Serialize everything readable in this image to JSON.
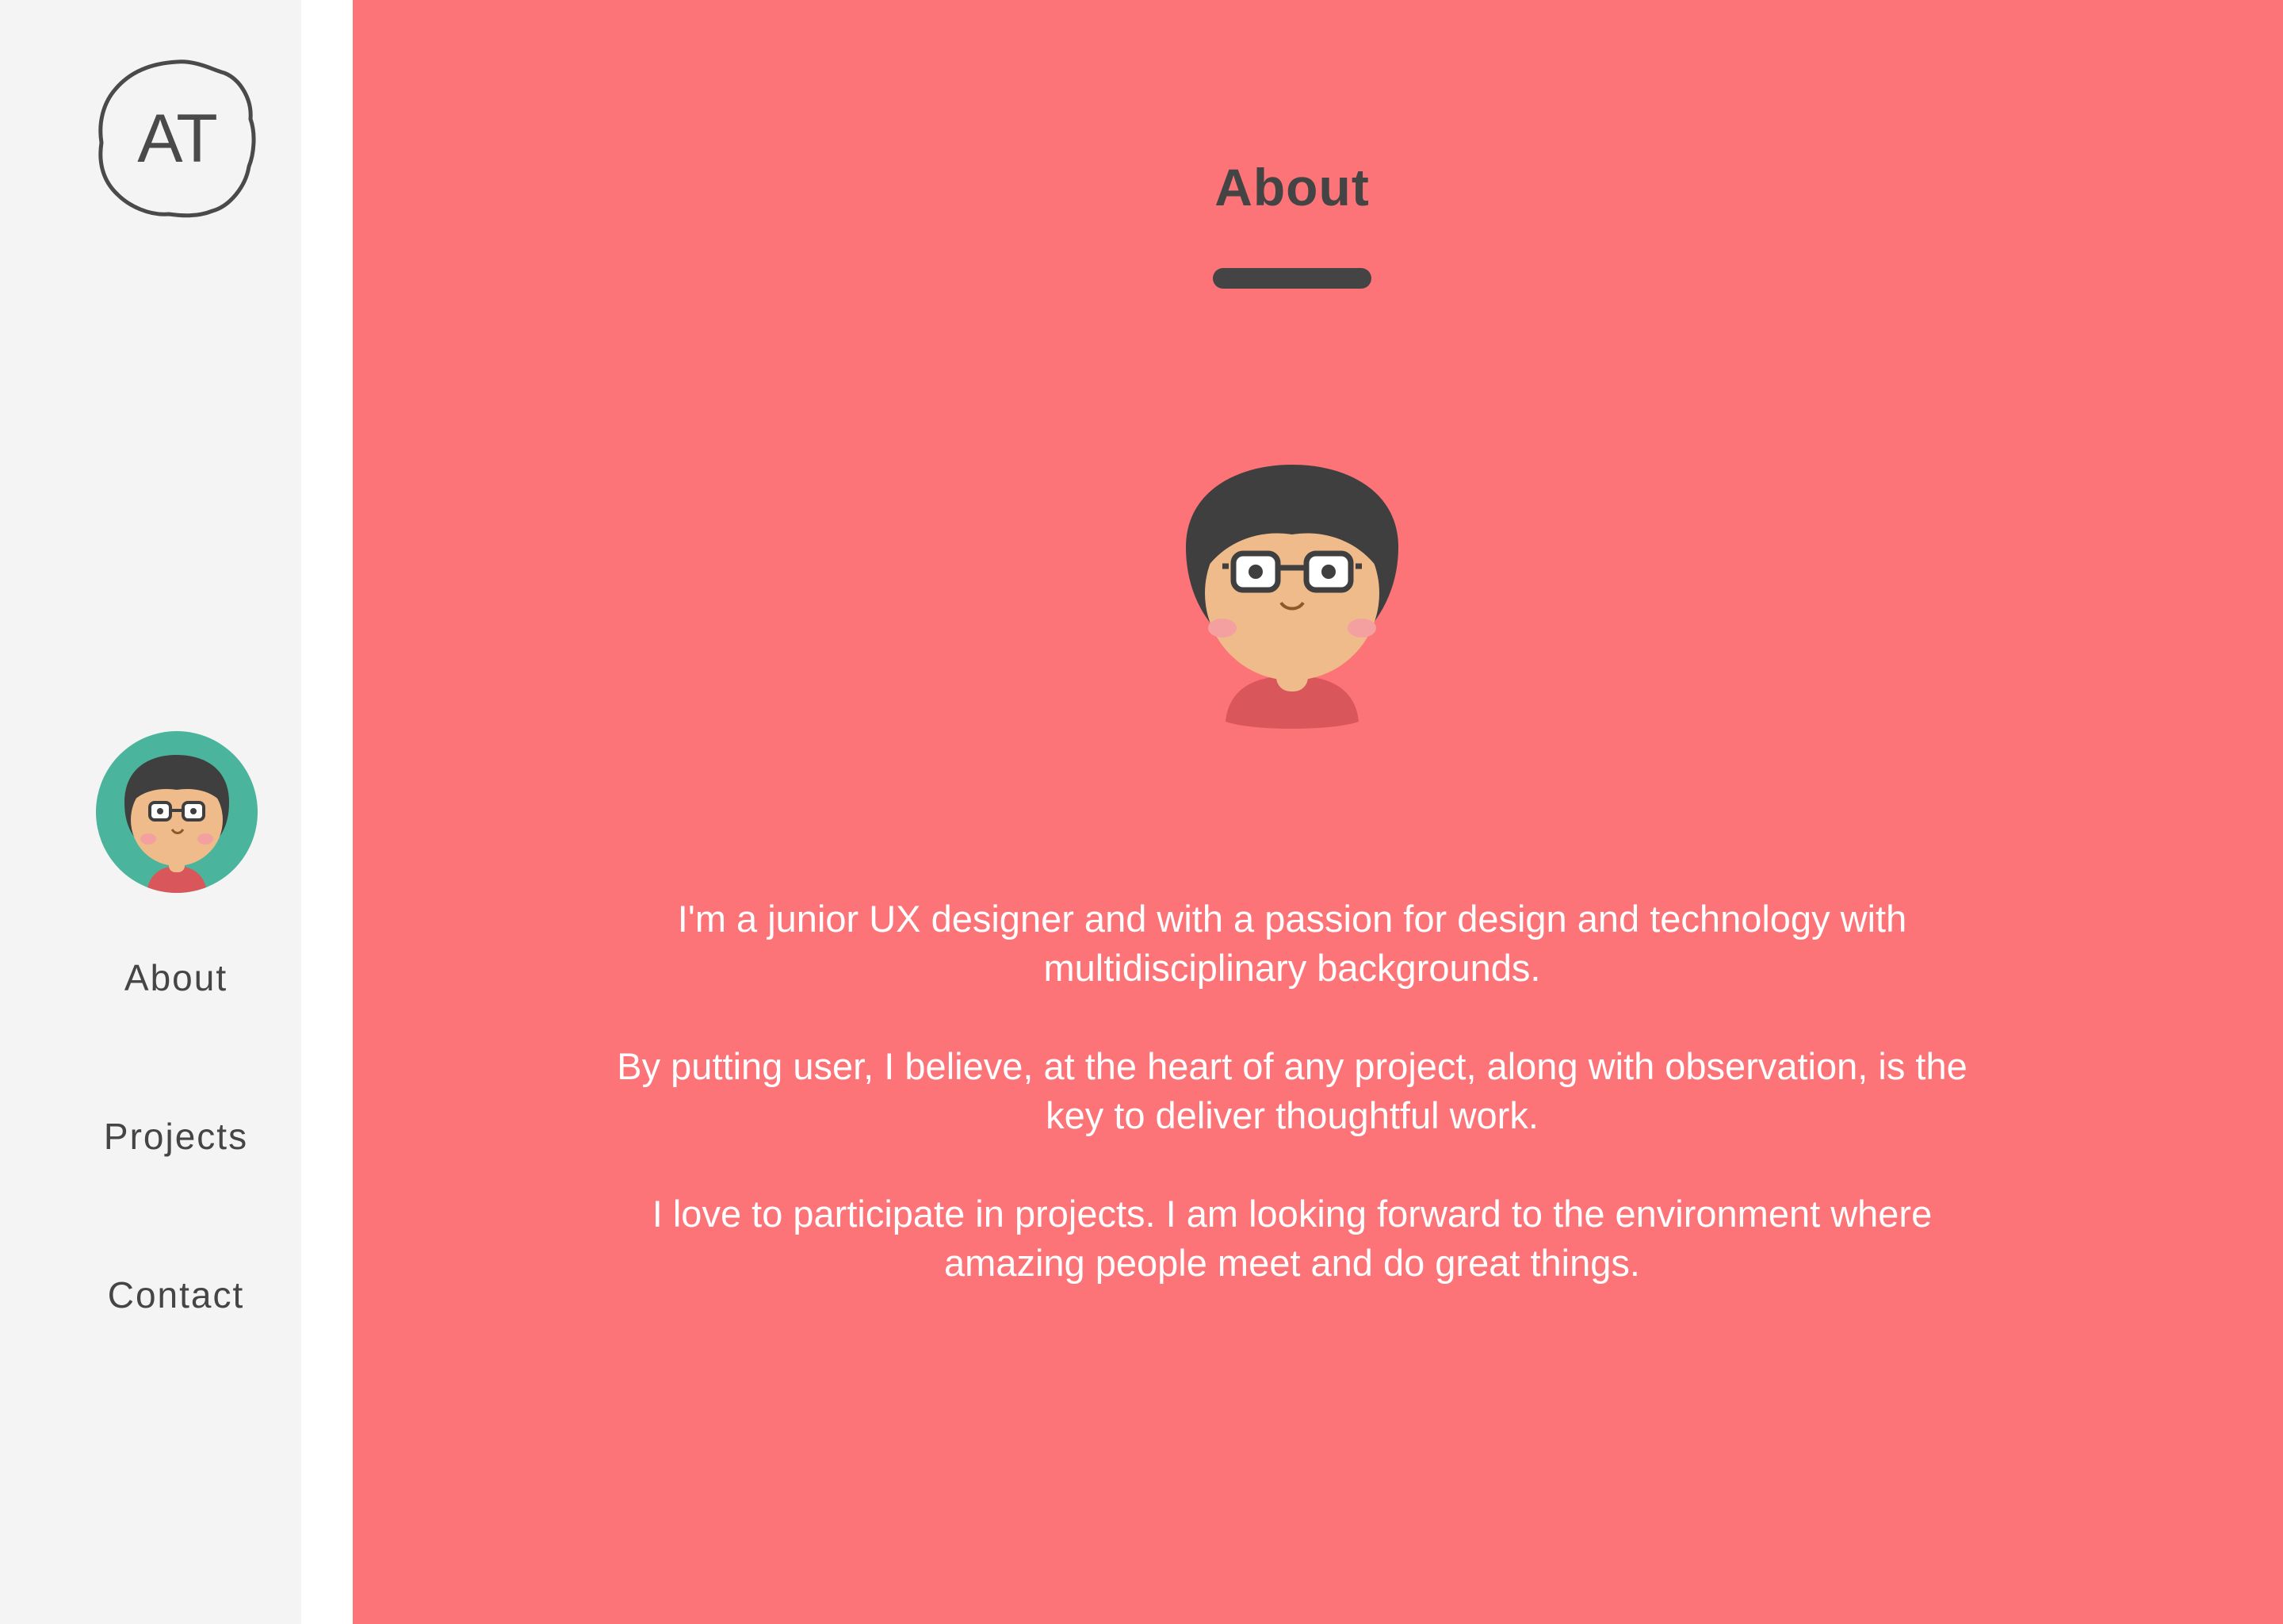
{
  "logo": {
    "initials": "AT"
  },
  "nav": {
    "items": [
      {
        "label": "About"
      },
      {
        "label": "Projects"
      },
      {
        "label": "Contact"
      }
    ]
  },
  "main": {
    "title": "About",
    "paragraphs": [
      "I'm a junior UX designer and with a passion for design and technology with multidisciplinary backgrounds.",
      "By putting user, I believe, at the heart of any project, along with observation, is the key to deliver thoughtful work.",
      "I love to participate in projects. I am looking forward to the environment where amazing people meet and do great things."
    ]
  },
  "colors": {
    "sidebar_bg": "#f4f4f4",
    "main_bg": "#fc7478",
    "avatar_ring": "#4ab59c",
    "text_dark": "#444444",
    "text_light": "#ffffff"
  },
  "icons": {
    "logo": "hand-drawn-circle-logo",
    "avatar": "cartoon-person-avatar"
  }
}
